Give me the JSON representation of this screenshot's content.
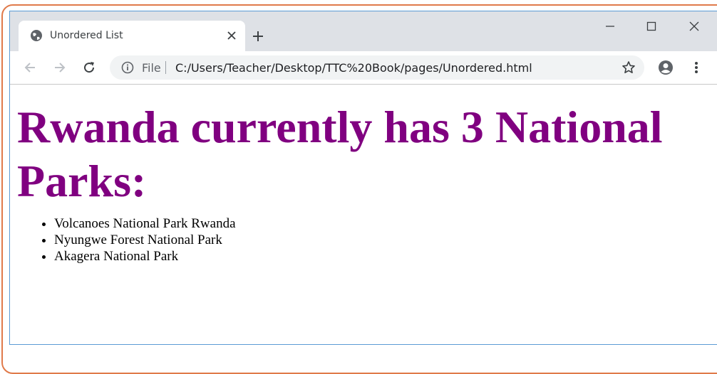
{
  "browser": {
    "tab_title": "Unordered List",
    "url_scheme_label": "File",
    "url": "C:/Users/Teacher/Desktop/TTC%20Book/pages/Unordered.html"
  },
  "page": {
    "heading": "Rwanda currently has 3 National Parks:",
    "list_items": [
      "Volcanoes National Park Rwanda",
      "Nyungwe Forest National Park",
      "Akagera National Park"
    ]
  },
  "colors": {
    "heading": "#800080",
    "frame_border": "#e07a4a",
    "window_border": "#5b9bd5",
    "tabstrip": "#dee1e6"
  },
  "icons": {
    "favicon": "globe-icon",
    "tab_close": "close-icon",
    "new_tab": "plus-icon",
    "minimize": "minimize-icon",
    "maximize": "maximize-icon",
    "close_window": "close-icon",
    "back": "back-arrow-icon",
    "forward": "forward-arrow-icon",
    "reload": "reload-icon",
    "info": "info-icon",
    "bookmark": "star-icon",
    "profile": "account-icon",
    "menu": "more-vert-icon"
  }
}
